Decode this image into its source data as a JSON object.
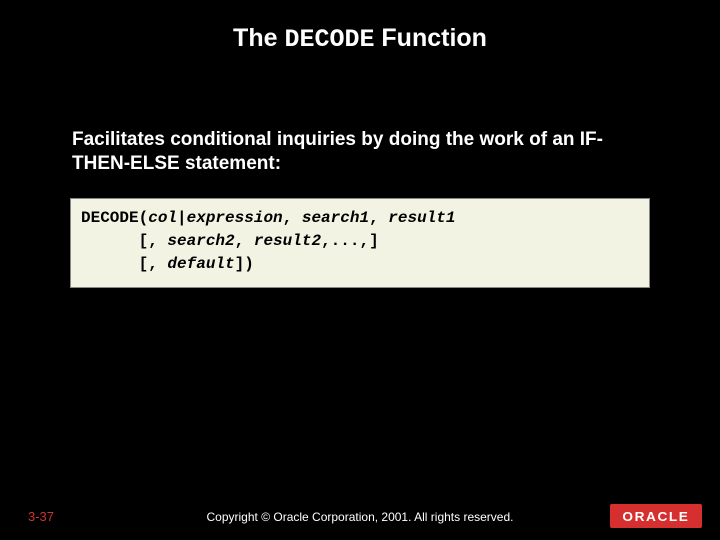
{
  "title": {
    "prefix": "The ",
    "keyword": "DECODE",
    "suffix": " Function"
  },
  "description": "Facilitates conditional inquiries by doing the work of an IF-THEN-ELSE statement:",
  "code": {
    "fn": "DECODE(",
    "arg1": "col|expression",
    "sep1": ", ",
    "arg2": "search1",
    "sep2": ", ",
    "arg3": "result1",
    "line2_open": "      [, ",
    "arg4": "search2",
    "sep3": ", ",
    "arg5": "result2",
    "line2_close": ",...,]",
    "line3_open": "      [, ",
    "arg6": "default",
    "line3_close": "])"
  },
  "footer": {
    "page": "3-37",
    "copyright": "Copyright © Oracle Corporation, 2001. All rights reserved.",
    "logo_text": "ORACLE"
  }
}
